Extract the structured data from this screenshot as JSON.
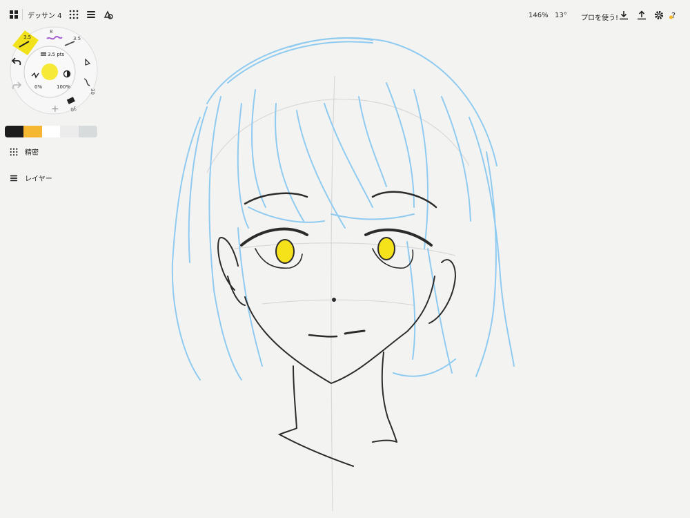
{
  "app": {
    "doc_title": "デッサン 4"
  },
  "topbar": {
    "zoom": "146%",
    "rotation": "13°",
    "pro_label": "プロを使う!"
  },
  "brush_wheel": {
    "size_label": "3.5 pts",
    "opacity_left": "0%",
    "opacity_right": "100%",
    "tools": [
      {
        "name": "pencil",
        "value": "3.5",
        "color": "#f2d21b"
      },
      {
        "name": "pen",
        "value": "8",
        "color": "#a55fd0"
      },
      {
        "name": "airbrush",
        "value": "3.5"
      },
      {
        "name": "selection",
        "value": ""
      },
      {
        "name": "smooth",
        "value": "30"
      },
      {
        "name": "eraser",
        "value": "30"
      }
    ],
    "current_color": "#f7e937"
  },
  "palette": {
    "colors": [
      "#1c1c1c",
      "#f5b731",
      "#ffffff",
      "#ececec",
      "#d8dbdc"
    ]
  },
  "sidebar": {
    "precision_label": "精密",
    "layers_label": "レイヤー"
  },
  "colors": {
    "accent": "#f5b731",
    "sketch_blue": "#8fcbf0",
    "ink": "#2b2b2b",
    "eye_yellow": "#f5e21b"
  }
}
